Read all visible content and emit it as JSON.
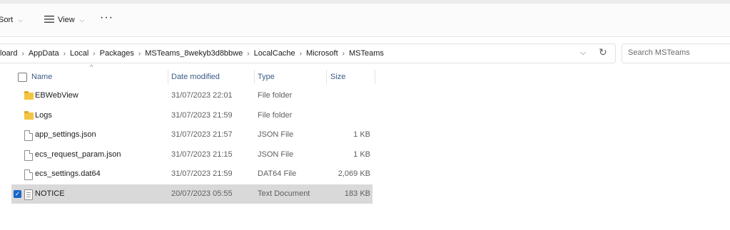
{
  "toolbar": {
    "sort_label": "Sort",
    "view_label": "View",
    "more_label": "···"
  },
  "address": {
    "crumbs": [
      "loard",
      "AppData",
      "Local",
      "Packages",
      "MSTeams_8wekyb3d8bbwe",
      "LocalCache",
      "Microsoft",
      "MSTeams"
    ]
  },
  "search": {
    "placeholder": "Search MSTeams"
  },
  "columns": {
    "name": "Name",
    "date": "Date modified",
    "type": "Type",
    "size": "Size"
  },
  "files": [
    {
      "name": "EBWebView",
      "date": "31/07/2023 22:01",
      "type": "File folder",
      "size": "",
      "icon": "folder-icon",
      "selected": false
    },
    {
      "name": "Logs",
      "date": "31/07/2023 21:59",
      "type": "File folder",
      "size": "",
      "icon": "folder-icon",
      "selected": false
    },
    {
      "name": "app_settings.json",
      "date": "31/07/2023 21:57",
      "type": "JSON File",
      "size": "1 KB",
      "icon": "file-icon",
      "selected": false
    },
    {
      "name": "ecs_request_param.json",
      "date": "31/07/2023 21:15",
      "type": "JSON File",
      "size": "1 KB",
      "icon": "file-icon",
      "selected": false
    },
    {
      "name": "ecs_settings.dat64",
      "date": "31/07/2023 21:59",
      "type": "DAT64 File",
      "size": "2,069 KB",
      "icon": "file-icon",
      "selected": false
    },
    {
      "name": "NOTICE",
      "date": "20/07/2023 05:55",
      "type": "Text Document",
      "size": "183 KB",
      "icon": "document-icon",
      "selected": true
    }
  ],
  "colors": {
    "accent": "#1a64c8",
    "selected_row": "#d9d9d9",
    "header_text": "#3c5b86",
    "folder": "#f3c542"
  }
}
